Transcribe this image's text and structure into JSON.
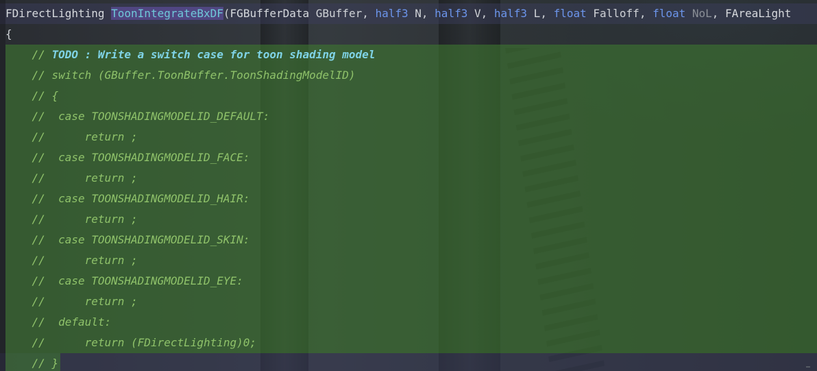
{
  "signature": {
    "return_type": "FDirectLighting",
    "function_name": "ToonIntegrateBxDF",
    "open_paren": "(",
    "p1_type": "FGBufferData",
    "p1_name": " GBuffer, ",
    "p2_type": "half3",
    "p2_name": " N, ",
    "p3_type": "half3",
    "p3_name": " V, ",
    "p4_type": "half3",
    "p4_name": " L, ",
    "p5_type": "float",
    "p5_name": " Falloff, ",
    "p6_type": "float",
    "p6_name": " NoL",
    "p6_sep": ", ",
    "p7_type": "FAreaLight"
  },
  "open_brace": "{",
  "comment_lines": [
    {
      "prefix": "    // ",
      "text": "TODO : Write a switch case for toon shading model",
      "todo": true
    },
    {
      "prefix": "    // ",
      "text": "switch (GBuffer.ToonBuffer.ToonShadingModelID)",
      "todo": false
    },
    {
      "prefix": "    // ",
      "text": "{",
      "todo": false
    },
    {
      "prefix": "    //  ",
      "text": "case TOONSHADINGMODELID_DEFAULT:",
      "todo": false
    },
    {
      "prefix": "    //      ",
      "text": "return ;",
      "todo": false
    },
    {
      "prefix": "    //  ",
      "text": "case TOONSHADINGMODELID_FACE:",
      "todo": false
    },
    {
      "prefix": "    //      ",
      "text": "return ;",
      "todo": false
    },
    {
      "prefix": "    //  ",
      "text": "case TOONSHADINGMODELID_HAIR:",
      "todo": false
    },
    {
      "prefix": "    //      ",
      "text": "return ;",
      "todo": false
    },
    {
      "prefix": "    //  ",
      "text": "case TOONSHADINGMODELID_SKIN:",
      "todo": false
    },
    {
      "prefix": "    //      ",
      "text": "return ;",
      "todo": false
    },
    {
      "prefix": "    //  ",
      "text": "case TOONSHADINGMODELID_EYE:",
      "todo": false
    },
    {
      "prefix": "    //      ",
      "text": "return ;",
      "todo": false
    },
    {
      "prefix": "    //  ",
      "text": "default:",
      "todo": false
    },
    {
      "prefix": "    //      ",
      "text": "return (FDirectLighting)0;",
      "todo": false
    },
    {
      "prefix": "    // ",
      "text": "}",
      "todo": false
    }
  ],
  "colors": {
    "selection": "#3e7630",
    "comment": "#8fc26a",
    "todo": "#7fd3e6",
    "keyword": "#6c95eb",
    "function_highlight": "#5f4ea0"
  }
}
